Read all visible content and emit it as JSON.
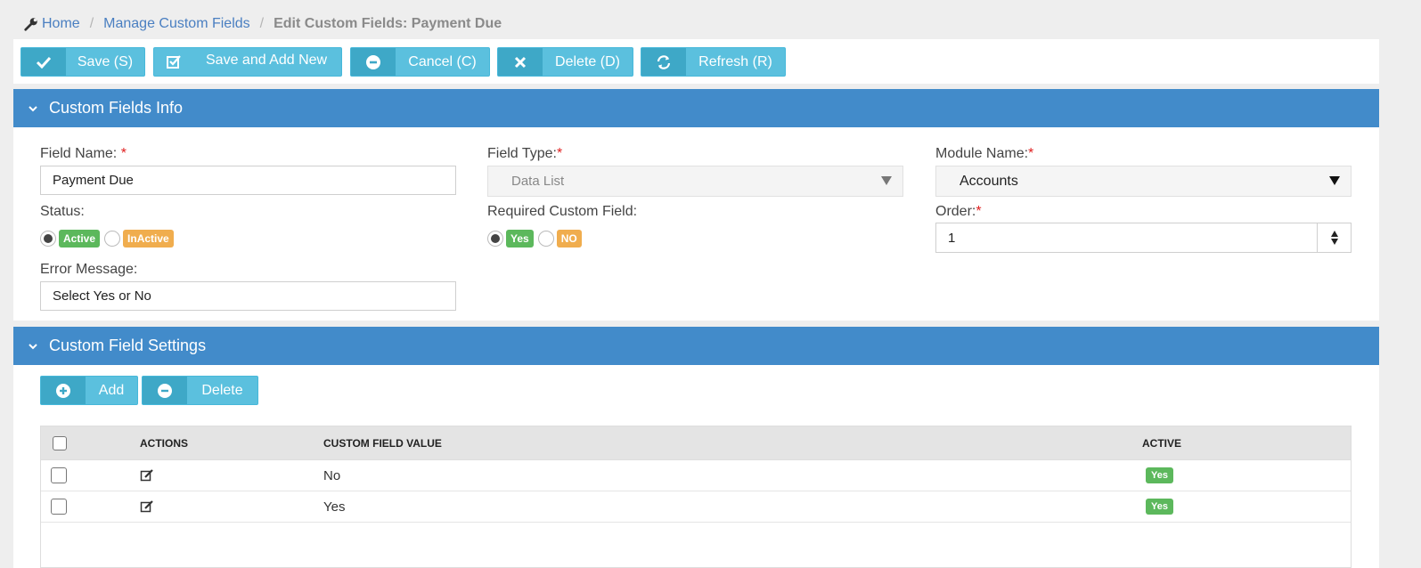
{
  "breadcrumb": {
    "home": "Home",
    "manage": "Manage Custom Fields",
    "current": "Edit Custom Fields: Payment Due"
  },
  "toolbar": {
    "save": "Save (S)",
    "save_add": "Save and Add New",
    "cancel": "Cancel (C)",
    "delete": "Delete (D)",
    "refresh": "Refresh (R)"
  },
  "info_panel": {
    "title": "Custom Fields Info",
    "field_name_label": "Field Name:",
    "field_name_value": "Payment Due",
    "field_type_label": "Field Type:",
    "field_type_value": "Data List",
    "module_name_label": "Module Name:",
    "module_name_value": "Accounts",
    "required_mark": "*",
    "status_label": "Status:",
    "status_active": "Active",
    "status_inactive": "InActive",
    "required_label": "Required Custom Field:",
    "required_yes": "Yes",
    "required_no": "NO",
    "order_label": "Order:",
    "order_value": "1",
    "error_label": "Error Message:",
    "error_value": "Select Yes or No"
  },
  "settings_panel": {
    "title": "Custom Field Settings",
    "add": "Add",
    "delete": "Delete",
    "columns": {
      "actions": "ACTIONS",
      "value": "CUSTOM FIELD VALUE",
      "active": "ACTIVE"
    },
    "rows": [
      {
        "value": "No",
        "active": "Yes"
      },
      {
        "value": "Yes",
        "active": "Yes"
      }
    ]
  },
  "colors": {
    "panel_header": "#428bca",
    "button": "#5bc0de",
    "button_icon": "#3ea8c7",
    "success": "#5cb85c",
    "warning": "#f0ad4e",
    "required": "#e02020"
  }
}
